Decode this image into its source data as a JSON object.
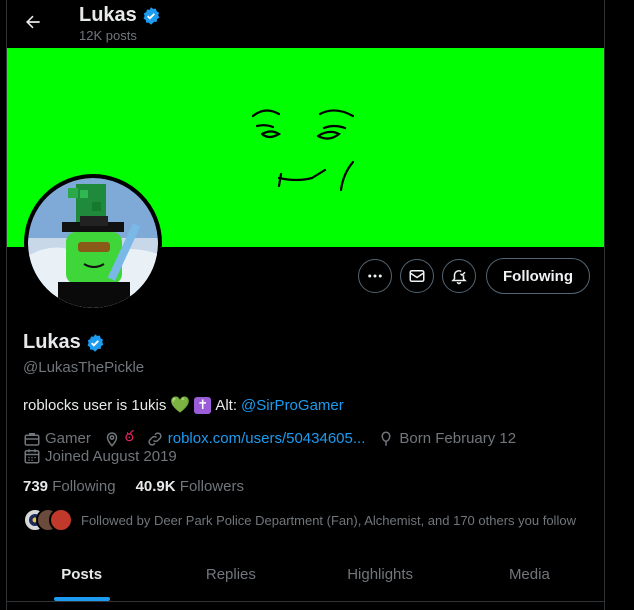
{
  "header": {
    "name": "Lukas",
    "posts_count": "12K posts"
  },
  "profile": {
    "name": "Lukas",
    "handle": "@LukasThePickle",
    "bio_text": "roblocks user is 1ukis",
    "bio_heart": "💚",
    "bio_cross": "✝",
    "bio_alt_label": "Alt:",
    "bio_alt_link": "@SirProGamer",
    "category": "Gamer",
    "location": "ఠ",
    "website": "roblox.com/users/50434605...",
    "birthday": "Born February 12",
    "joined": "Joined August 2019",
    "following_count": "739",
    "following_label": "Following",
    "followers_count": "40.9K",
    "followers_label": "Followers",
    "followed_by": "Followed by Deer Park Police Department (Fan), Alchemist, and 170 others you follow"
  },
  "actions": {
    "follow_label": "Following"
  },
  "tabs": [
    {
      "label": "Posts",
      "active": true
    },
    {
      "label": "Replies",
      "active": false
    },
    {
      "label": "Highlights",
      "active": false
    },
    {
      "label": "Media",
      "active": false
    }
  ],
  "colors": {
    "background": "#000000",
    "banner": "#00ff00",
    "accent": "#1d9bf0",
    "text_secondary": "#71767b"
  },
  "icons": [
    "back-arrow-icon",
    "verified-badge-icon",
    "more-icon",
    "message-icon",
    "notification-bell-icon",
    "briefcase-icon",
    "location-icon",
    "link-icon",
    "birthday-icon",
    "calendar-icon"
  ]
}
